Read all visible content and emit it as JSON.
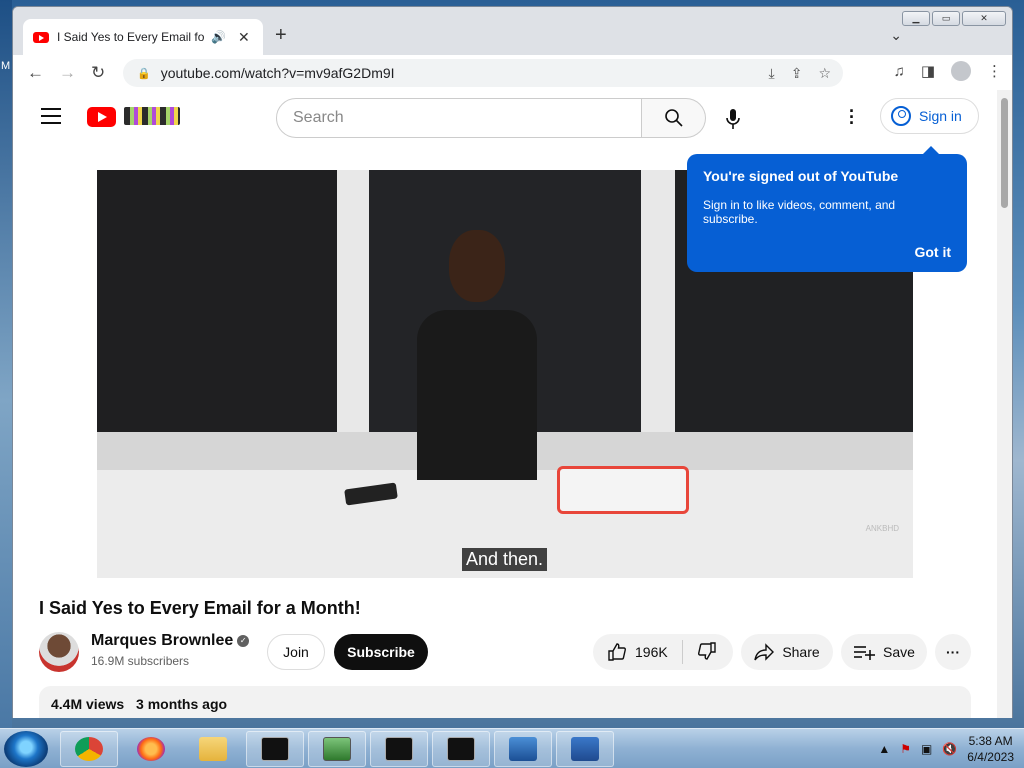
{
  "desktop": {
    "edge_label": "M"
  },
  "browser": {
    "tab_title": "I Said Yes to Every Email for a Month!",
    "tab_audio_icon": "speaker-icon",
    "new_tab_label": "+",
    "url": "youtube.com/watch?v=mv9afG2Dm9I",
    "window_controls": [
      "minimize",
      "maximize",
      "close"
    ]
  },
  "youtube": {
    "search_placeholder": "Search",
    "sign_in_label": "Sign in",
    "tooltip": {
      "title": "You're signed out of YouTube",
      "body": "Sign in to like videos, comment, and subscribe.",
      "action": "Got it"
    },
    "video": {
      "caption": "And then.",
      "watermark": "ANKBHD",
      "title": "I Said Yes to Every Email for a Month!"
    },
    "channel": {
      "name": "Marques Brownlee",
      "subscribers": "16.9M subscribers",
      "join_label": "Join",
      "subscribe_label": "Subscribe"
    },
    "actions": {
      "likes": "196K",
      "share_label": "Share",
      "save_label": "Save"
    },
    "description": {
      "views": "4.4M views",
      "age": "3 months ago"
    }
  },
  "taskbar": {
    "time": "5:38 AM",
    "date": "6/4/2023",
    "items": [
      "chrome",
      "firefox",
      "file-explorer",
      "cmd",
      "task-manager",
      "cmd",
      "cmd",
      "server-manager",
      "powershell"
    ]
  },
  "colors": {
    "youtube_red": "#ff0000",
    "tooltip_blue": "#065fd4",
    "subscribe_black": "#0f0f0f"
  }
}
